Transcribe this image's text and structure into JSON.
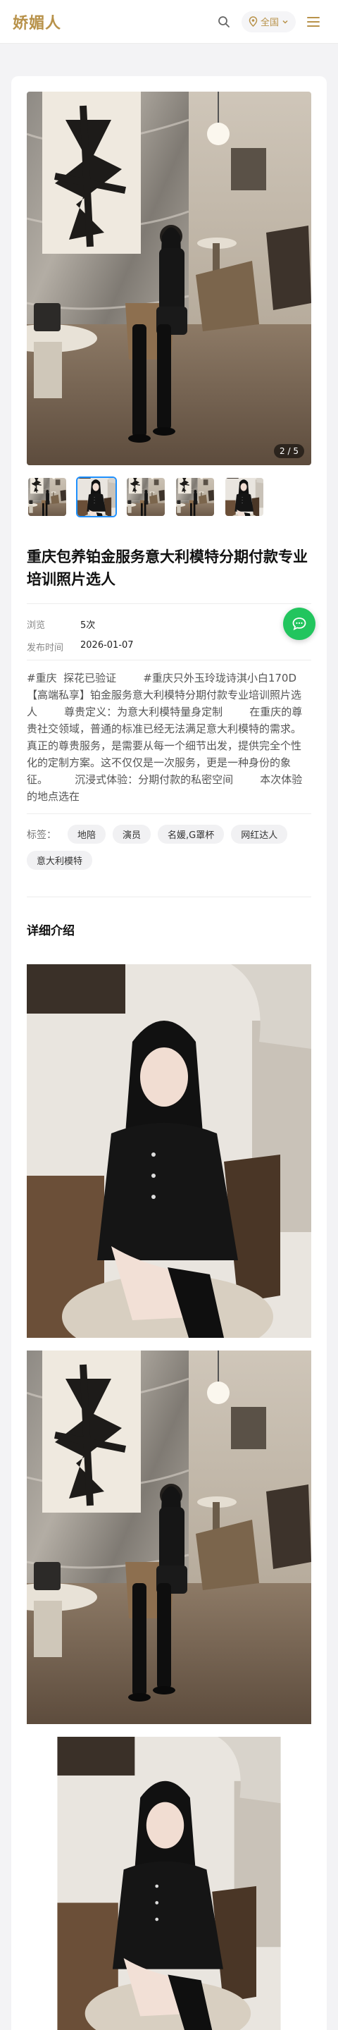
{
  "header": {
    "logo": "娇媚人",
    "region_label": "全国"
  },
  "gallery": {
    "counter": "2 / 5",
    "thumb_count": 5,
    "active_thumb": 2
  },
  "post": {
    "title": "重庆包养铂金服务意大利模特分期付款专业培训照片选人",
    "meta": [
      {
        "key": "浏览",
        "value": "5次"
      },
      {
        "key": "发布时间",
        "value": "2026-01-07"
      }
    ],
    "description": "#重庆  探花已验证        #重庆只外玉玲珑诗淇小白170D        【高端私享】铂金服务意大利模特分期付款专业培训照片选人        尊贵定义：为意大利模特量身定制        在重庆的尊贵社交领域，普通的标准已经无法满足意大利模特的需求。真正的尊贵服务，是需要从每一个细节出发，提供完全个性化的定制方案。这不仅仅是一次服务，更是一种身份的象征。        沉浸式体验：分期付款的私密空间        本次体验的地点选在",
    "tags_label": "标签：",
    "tags": [
      "地陪",
      "演员",
      "名媛,G罩杯",
      "网红达人",
      "意大利模特"
    ],
    "detail_title": "详细介绍"
  },
  "colors": {
    "brand": "#b8924a",
    "accent": "#1e90ff",
    "chat": "#22c55e"
  },
  "icons": [
    "search-icon",
    "location-pin-icon",
    "chevron-down-icon",
    "menu-icon",
    "chat-icon"
  ]
}
